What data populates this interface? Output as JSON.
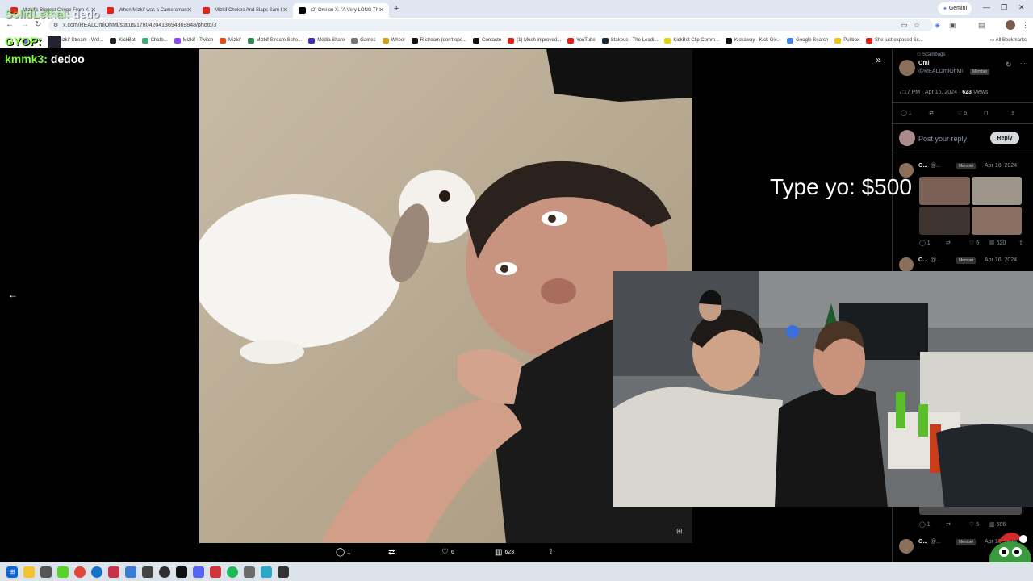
{
  "browser": {
    "tabs": [
      {
        "title": "Mizkif's Biggest Cringe From K",
        "favicon_color": "#e62117",
        "active": false
      },
      {
        "title": "When Mizkif was a Cameraman",
        "favicon_color": "#e62117",
        "active": false
      },
      {
        "title": "Mizkif Chokes And Slaps Sam I",
        "favicon_color": "#e62117",
        "active": false
      },
      {
        "title": "(2) Omi on X: \"A Very LONG Th",
        "favicon_color": "#000000",
        "active": true
      }
    ],
    "new_tab_icon": "plus-icon",
    "gemini_label": "Gemini",
    "url": "x.com/REALOmiOhMi/status/1780420413694369848/photo/3",
    "bookmarks": [
      {
        "label": "Clips",
        "color": "#8c52ff"
      },
      {
        "label": "Mizkif Stream - Wel...",
        "color": "#2e8b57"
      },
      {
        "label": "KickBot",
        "color": "#222222"
      },
      {
        "label": "Chatb...",
        "color": "#4a7"
      },
      {
        "label": "Mizkif - Twitch",
        "color": "#9146ff"
      },
      {
        "label": "Mizkif",
        "color": "#e64a19"
      },
      {
        "label": "Mizkif Stream Sche...",
        "color": "#2e8b57"
      },
      {
        "label": "Media Share",
        "color": "#3d2cc4"
      },
      {
        "label": "Games",
        "color": "#777777"
      },
      {
        "label": "Wheel",
        "color": "#d4a017"
      },
      {
        "label": "R.stream (don't ope...",
        "color": "#111111"
      },
      {
        "label": "Contacto",
        "color": "#111111"
      },
      {
        "label": "(1) Much improved...",
        "color": "#e62117"
      },
      {
        "label": "YouTube",
        "color": "#e62117"
      },
      {
        "label": "Stakeus - The Leadi...",
        "color": "#1a2c38"
      },
      {
        "label": "KickBot Clip Comm...",
        "color": "#e6d200"
      },
      {
        "label": "Kickaway - Kick Giv...",
        "color": "#111111"
      },
      {
        "label": "Google Search",
        "color": "#4285f4"
      },
      {
        "label": "Pullbox",
        "color": "#f4c20d"
      },
      {
        "label": "She just exposed Sc...",
        "color": "#e62117"
      }
    ],
    "all_bookmarks_label": "All Bookmarks"
  },
  "chat": [
    {
      "user": "SolidLethal:",
      "message": "dedo",
      "dim": true
    },
    {
      "user": "GYOP:",
      "message": "",
      "dim": false
    },
    {
      "user": "kmmk3:",
      "message": "dedoo",
      "dim": false
    }
  ],
  "donation_text": "Type yo: $500",
  "post": {
    "community": "Scambags",
    "author": "Omi",
    "handle": "@REALOmiOhMi",
    "member_badge": "Member",
    "time": "7:17 PM · Apr 16, 2024",
    "views_count": "623",
    "views_label": "Views",
    "stats": {
      "replies": "1",
      "retweets": "",
      "likes": "6"
    },
    "reply_placeholder": "Post your reply",
    "reply_button": "Reply"
  },
  "replies": [
    {
      "author": "O...",
      "handle": "@...",
      "badge": "Member",
      "date": "Apr 16, 2024",
      "replies": "1",
      "likes": "6",
      "views": "620"
    },
    {
      "author": "O...",
      "handle": "@...",
      "badge": "Member",
      "date": "Apr 16, 2024",
      "replies": "1",
      "likes": "5",
      "views": "606"
    },
    {
      "author": "O...",
      "handle": "@...",
      "badge": "Member",
      "date": "Apr 16, 2024"
    }
  ],
  "photo_actions": {
    "replies": "1",
    "retweets": "",
    "likes": "6",
    "views": "623"
  },
  "colors": {
    "accent_green": "#7cfc3b",
    "x_blue": "#1d9bf0",
    "sidebar_bg": "#000000"
  }
}
